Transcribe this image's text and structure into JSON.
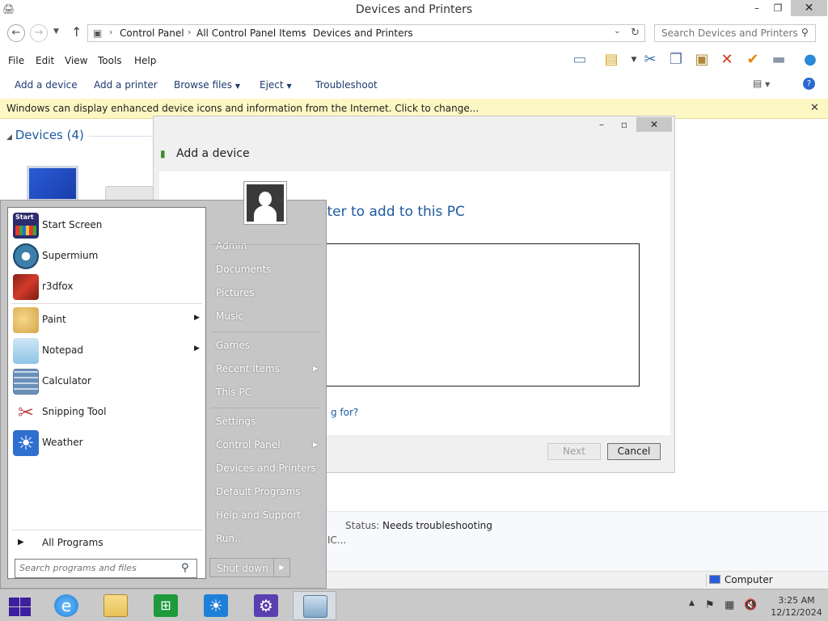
{
  "window": {
    "title": "Devices and Printers",
    "minimize": "–",
    "maximize": "❐",
    "close": "✕"
  },
  "address": {
    "crumbs": [
      "Control Panel",
      "All Control Panel Items",
      "Devices and Printers"
    ],
    "search_placeholder": "Search Devices and Printers"
  },
  "menu": [
    "File",
    "Edit",
    "View",
    "Tools",
    "Help"
  ],
  "commands": {
    "add_device": "Add a device",
    "add_printer": "Add a printer",
    "browse_files": "Browse files",
    "eject": "Eject",
    "troubleshoot": "Troubleshoot"
  },
  "infobar": {
    "message": "Windows can display enhanced device icons and information from the Internet. Click to change...",
    "close": "✕"
  },
  "devices_group": {
    "label": "Devices (4)"
  },
  "wizard": {
    "header": "Add a device",
    "heading_visible": "inter to add to this PC",
    "link_visible": "g for?",
    "next": "Next",
    "cancel": "Cancel"
  },
  "details": {
    "status_label": "Status:",
    "status_value": "Needs troubleshooting",
    "truncated": "IC..."
  },
  "statusbar": {
    "computer": "Computer"
  },
  "startmenu": {
    "pinned": [
      {
        "label": "Start Screen",
        "icon": "start-screen-icon",
        "color": "#2b2b6e"
      },
      {
        "label": "Supermium",
        "icon": "supermium-icon",
        "color": "#3d7fa8"
      },
      {
        "label": "r3dfox",
        "icon": "r3dfox-icon",
        "color": "#d23b2a"
      }
    ],
    "programs": [
      {
        "label": "Paint",
        "icon": "paint-icon",
        "color": "#e0b35a",
        "submenu": true
      },
      {
        "label": "Notepad",
        "icon": "notepad-icon",
        "color": "#8fc4e6",
        "submenu": true
      },
      {
        "label": "Calculator",
        "icon": "calculator-icon",
        "color": "#6a8fb8",
        "submenu": false
      },
      {
        "label": "Snipping Tool",
        "icon": "snipping-tool-icon",
        "color": "#c04848",
        "submenu": false
      },
      {
        "label": "Weather",
        "icon": "weather-icon",
        "color": "#2f6fd0",
        "submenu": false
      }
    ],
    "all_programs": "All Programs",
    "search_placeholder": "Search programs and files",
    "right_items": [
      {
        "label": "Admin",
        "submenu": false
      },
      {
        "label": "Documents",
        "submenu": false
      },
      {
        "label": "Pictures",
        "submenu": false
      },
      {
        "label": "Music",
        "submenu": false
      },
      {
        "label": "Games",
        "submenu": false
      },
      {
        "label": "Recent Items",
        "submenu": true
      },
      {
        "label": "This PC",
        "submenu": false
      },
      {
        "label": "Settings",
        "submenu": false
      },
      {
        "label": "Control Panel",
        "submenu": true
      },
      {
        "label": "Devices and Printers",
        "submenu": false
      },
      {
        "label": "Default Programs",
        "submenu": false
      },
      {
        "label": "Help and Support",
        "submenu": false
      },
      {
        "label": "Run...",
        "submenu": false
      }
    ],
    "shutdown": "Shut down"
  },
  "taskbar": {
    "apps": [
      {
        "name": "internet-explorer-icon",
        "color": "#1f7fd6"
      },
      {
        "name": "file-explorer-icon",
        "color": "#e8c25a"
      },
      {
        "name": "store-icon",
        "color": "#1c9a3c"
      },
      {
        "name": "weather-app-icon",
        "color": "#1e7fd8"
      },
      {
        "name": "settings-icon",
        "color": "#5b3fb0"
      },
      {
        "name": "control-panel-icon",
        "color": "#7fa8c8"
      }
    ],
    "time": "3:25 AM",
    "date": "12/12/2024"
  }
}
